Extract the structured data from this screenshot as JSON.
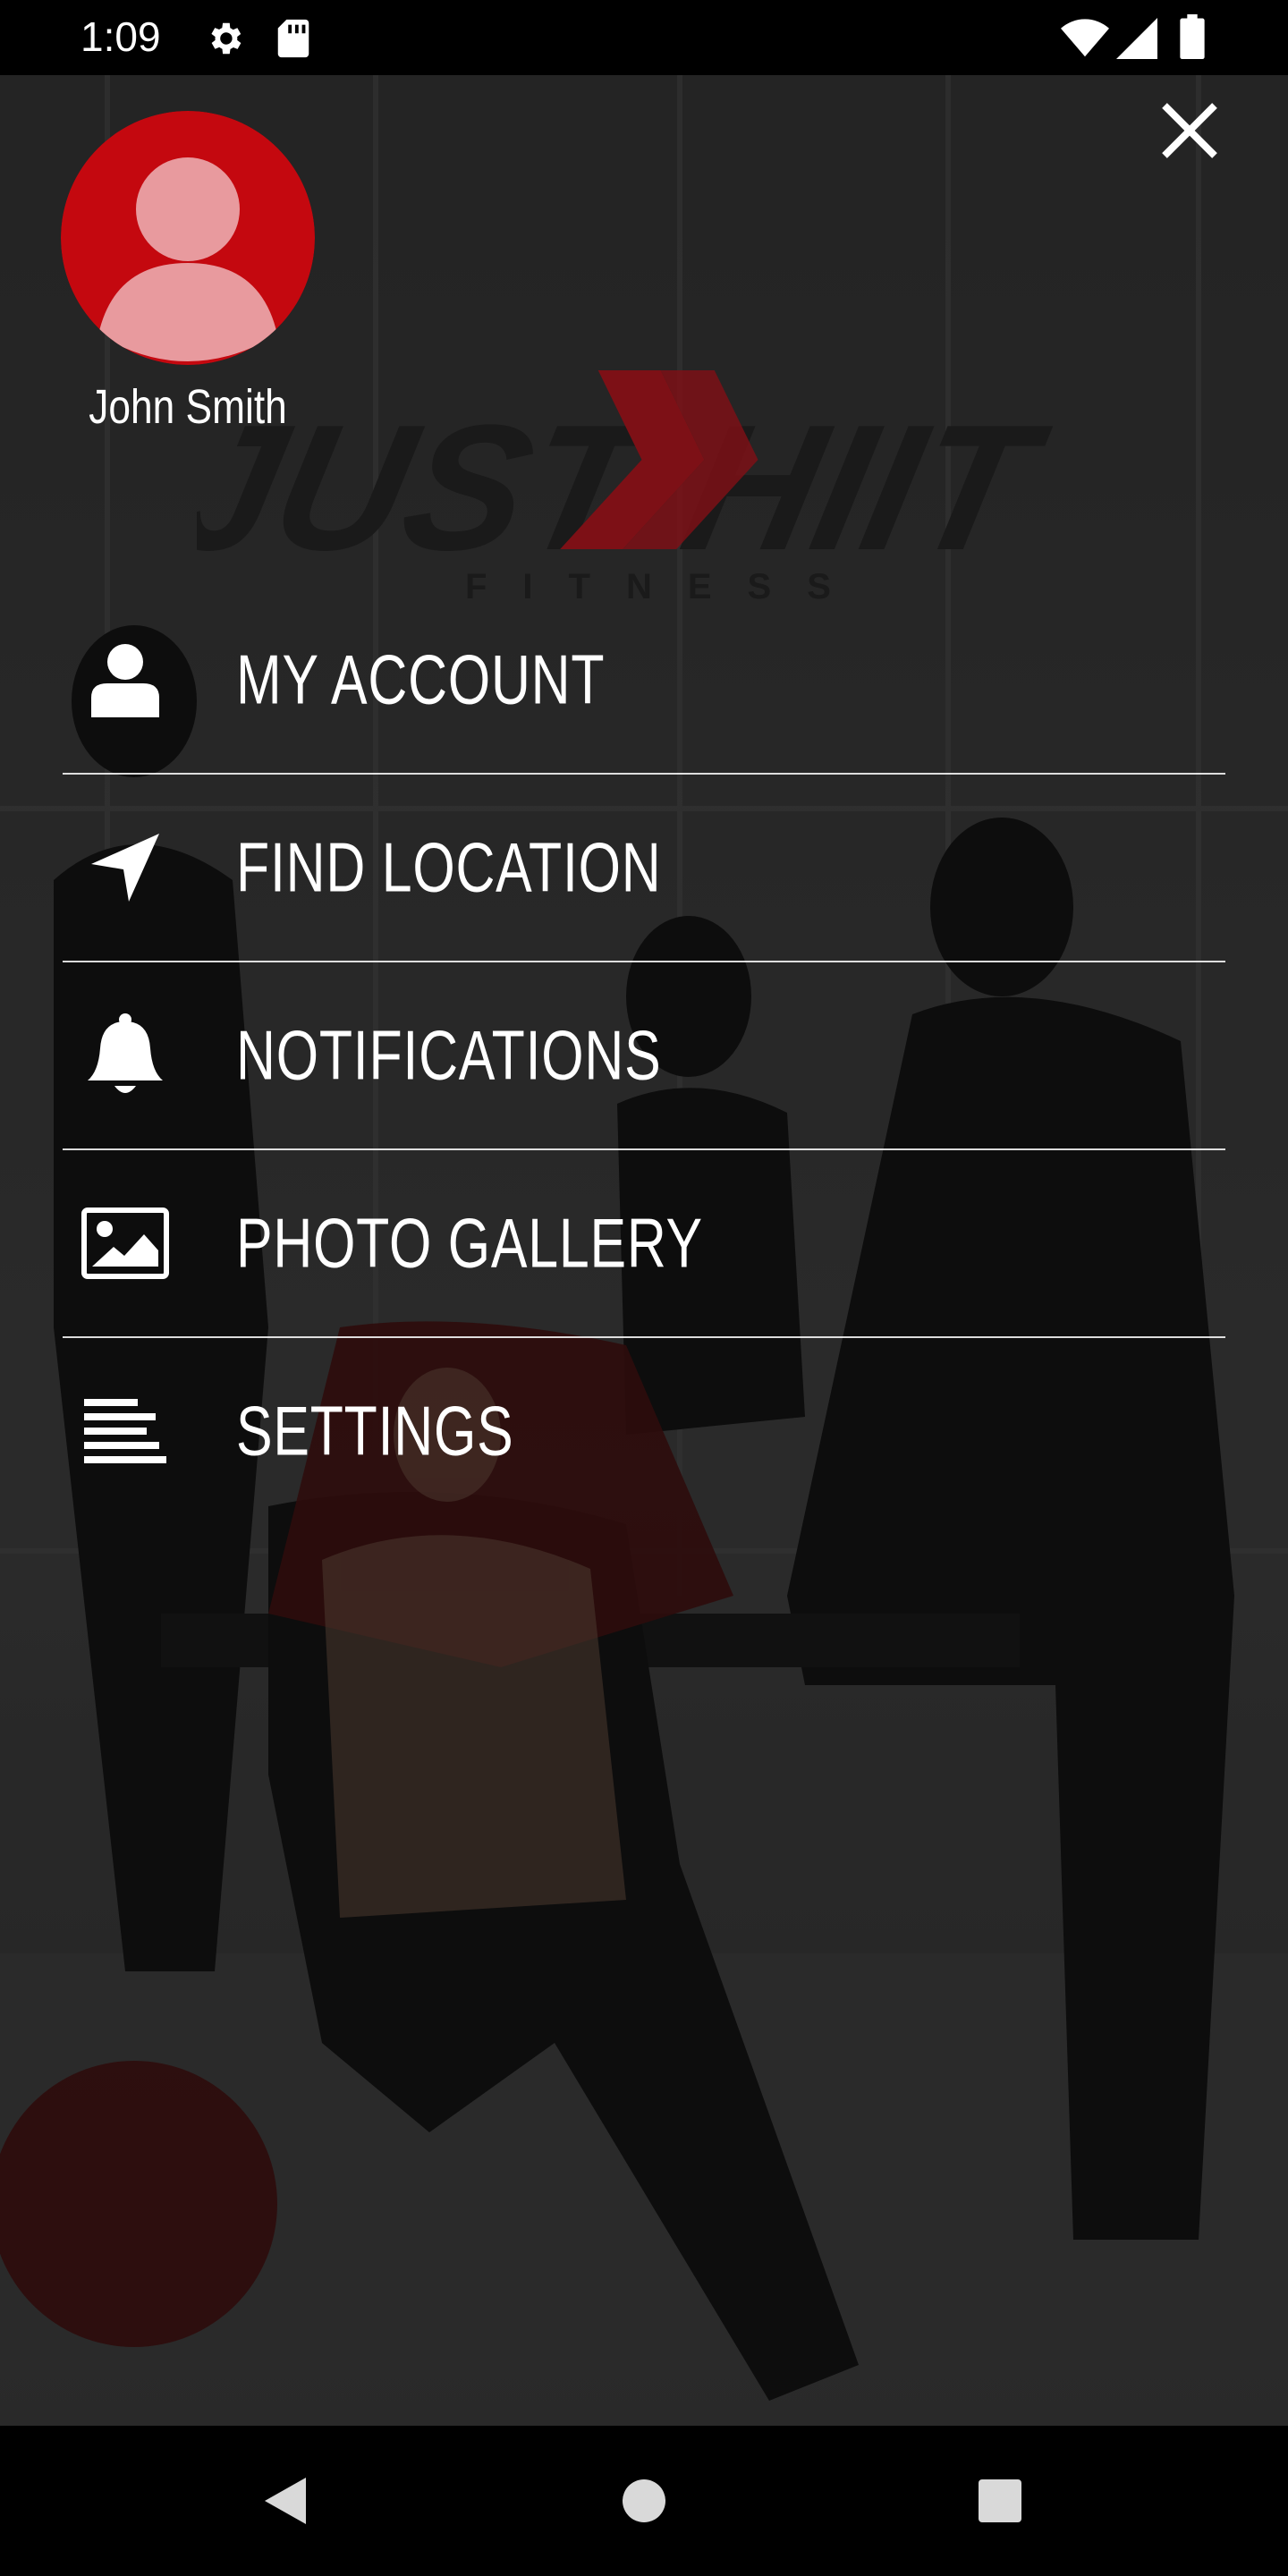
{
  "status_bar": {
    "time": "1:09",
    "icons": [
      "gear-icon",
      "sd-card-icon",
      "wifi-icon",
      "cell-signal-icon",
      "battery-icon"
    ]
  },
  "drawer": {
    "close_icon": "close-icon",
    "user": {
      "name": "John Smith",
      "avatar_icon": "person-avatar-icon",
      "avatar_color": "#c4080f"
    },
    "logo": {
      "text": "JUST HIIT",
      "sub": "FITNESS",
      "accent": "#b3121a"
    },
    "menu": [
      {
        "label": "MY ACCOUNT",
        "icon": "person-icon"
      },
      {
        "label": "FIND LOCATION",
        "icon": "navigation-arrow-icon"
      },
      {
        "label": "NOTIFICATIONS",
        "icon": "bell-icon"
      },
      {
        "label": "PHOTO GALLERY",
        "icon": "image-icon"
      },
      {
        "label": "SETTINGS",
        "icon": "settings-lines-icon"
      }
    ]
  },
  "nav_bar": {
    "buttons": [
      "back-icon",
      "home-icon",
      "recents-icon"
    ]
  }
}
